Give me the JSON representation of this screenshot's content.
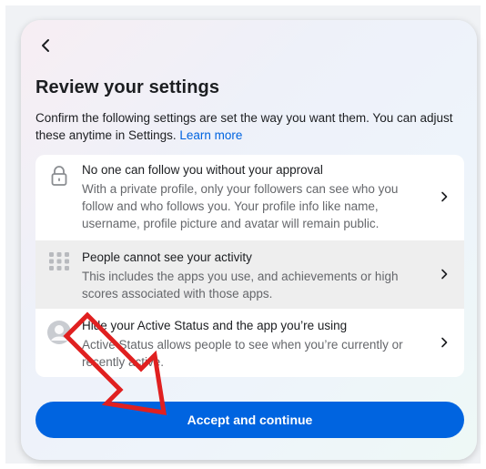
{
  "header": {
    "back_icon": "chevron-left-icon",
    "title": "Review your settings",
    "description": "Confirm the following settings are set the way you want them. You can adjust these anytime in Settings.",
    "learn_more": "Learn more"
  },
  "settings": [
    {
      "icon": "lock-icon",
      "title": "No one can follow you without your approval",
      "body": "With a private profile, only your followers can see who you follow and who follows you. Your profile info like name, username, profile picture and avatar will remain public."
    },
    {
      "icon": "apps-grid-icon",
      "title": "People cannot see your activity",
      "body": "This includes the apps you use, and achievements or high scores associated with those apps."
    },
    {
      "icon": "avatar-icon",
      "title": "Hide your Active Status and the app you’re using",
      "body": "Active Status allows people to see when you’re currently or recently active."
    }
  ],
  "actions": {
    "accept_label": "Accept and continue"
  },
  "colors": {
    "accent": "#0064e0",
    "annotation_arrow": "#e02020"
  }
}
